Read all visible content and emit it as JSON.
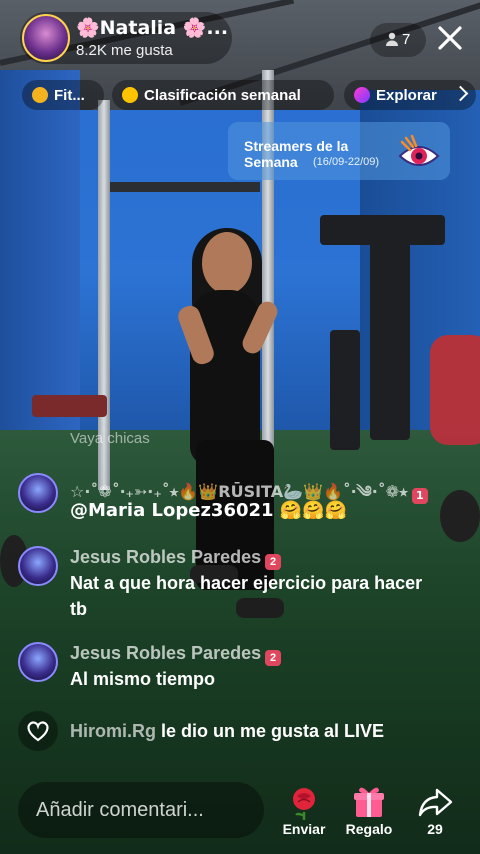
{
  "header": {
    "host_name": "🌸Natalia 🌸...",
    "likes": "8.2K me gusta",
    "viewers": "7"
  },
  "chips": {
    "fit": "Fit...",
    "ranking": "Clasificación semanal",
    "explore": "Explorar"
  },
  "streamers_card": {
    "title": "Streamers de la Semana",
    "dates": "(16/09-22/09)"
  },
  "chat": {
    "ghost": "Vaya chicas",
    "messages": [
      {
        "name": "☆·˚❁˚‧₊➳·₊˚⭑🔥👑RŪSITA🦢👑🔥˚‧༄·˚❁⭑",
        "badge": "1",
        "text": "@Maria Lopez36021 🤗🤗🤗"
      },
      {
        "name": "Jesus Robles Paredes",
        "badge": "2",
        "text": "Nat a que hora hacer ejercicio para hacer tb"
      },
      {
        "name": "Jesus Robles Paredes",
        "badge": "2",
        "text": "Al mismo tiempo"
      }
    ],
    "like_event": {
      "user": "Hiromi.Rg",
      "text": " le dio un me gusta al LIVE"
    }
  },
  "bottom": {
    "comment_placeholder": "Añadir comentari...",
    "send_label": "Enviar",
    "gift_label": "Regalo",
    "share_count": "29"
  },
  "icons": {
    "viewers": "person-icon",
    "close": "close-icon",
    "heart": "heart-icon",
    "rose": "rose-icon",
    "gift": "gift-icon",
    "share": "share-icon"
  },
  "colors": {
    "accent_pink": "#e0475f",
    "gold": "#ffd34d",
    "card_blue": "#5096dc"
  }
}
